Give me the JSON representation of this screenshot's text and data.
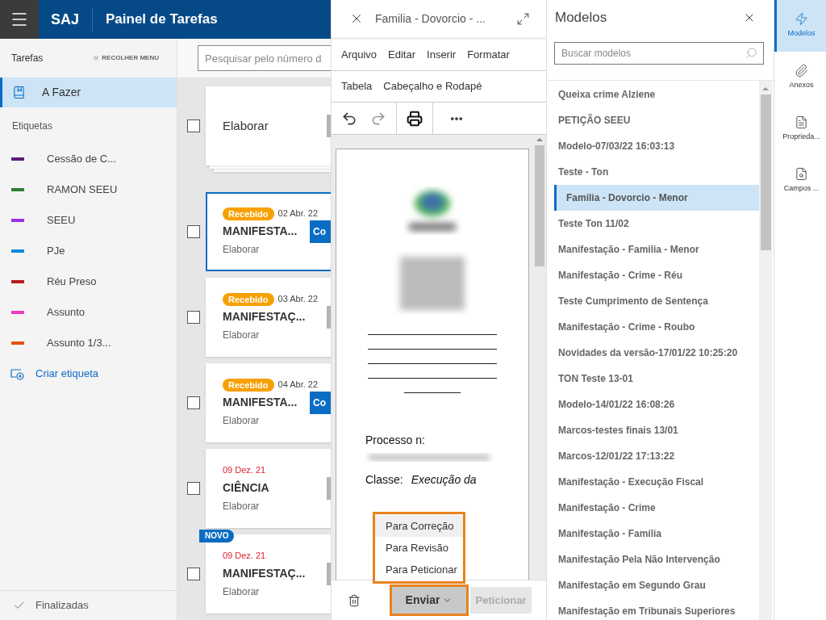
{
  "header": {
    "app_name": "SAJ",
    "title": "Painel de Tarefas"
  },
  "sidebar": {
    "section_title": "Tarefas",
    "collapse_label": "RECOLHER MENU",
    "items": [
      {
        "label": "A Fazer",
        "selected": true
      }
    ],
    "labels_title": "Etiquetas",
    "labels": [
      {
        "name": "Cessão de C...",
        "color": "#5c1a7a"
      },
      {
        "name": "RAMON SEEU",
        "color": "#2e7d32"
      },
      {
        "name": "SEEU",
        "color": "#9b30e6"
      },
      {
        "name": "PJe",
        "color": "#0a8ad6"
      },
      {
        "name": "Réu Preso",
        "color": "#b71c1c"
      },
      {
        "name": "Assunto",
        "color": "#f03cc0"
      },
      {
        "name": "Assunto 1/3...",
        "color": "#e65100"
      }
    ],
    "create_label": "Criar etiqueta",
    "footer": {
      "label": "Finalizadas"
    }
  },
  "task_list": {
    "search": {
      "placeholder": "Pesquisar pelo número d"
    },
    "tasks": [
      {
        "kind": "stack",
        "title": "Elaborar",
        "checked": false,
        "selected": false,
        "action": {
          "kind": "secondary"
        }
      },
      {
        "kind": "card",
        "status": "Recebido",
        "date": "02 Abr. 22",
        "overdue": false,
        "title": "MANIFESTA...",
        "subtitle": "Elaborar",
        "checked": false,
        "selected": true,
        "action": {
          "kind": "primary",
          "label": "Co"
        }
      },
      {
        "kind": "card",
        "status": "Recebido",
        "date": "03 Abr. 22",
        "overdue": false,
        "title": "MANIFESTAÇ...",
        "subtitle": "Elaborar",
        "checked": false,
        "selected": false,
        "action": {
          "kind": "secondary"
        }
      },
      {
        "kind": "card",
        "status": "Recebido",
        "date": "04 Abr. 22",
        "overdue": false,
        "title": "MANIFESTA...",
        "subtitle": "Elaborar",
        "checked": false,
        "selected": false,
        "action": {
          "kind": "primary",
          "label": "Co"
        }
      },
      {
        "kind": "card",
        "date": "09 Dez. 21",
        "overdue": true,
        "title": "CIÊNCIA",
        "subtitle": "Elaborar",
        "checked": false,
        "selected": false,
        "action": {
          "kind": "secondary"
        }
      },
      {
        "kind": "card",
        "badge": "NOVO",
        "date": "09 Dez. 21",
        "overdue": true,
        "title": "MANIFESTAÇ...",
        "subtitle": "Elaborar",
        "checked": false,
        "selected": false,
        "action": {
          "kind": "secondary"
        }
      }
    ]
  },
  "editor": {
    "title": "Familia - Dovorcio - ...",
    "menu_rows": [
      [
        "Arquivo",
        "Editar",
        "Inserir",
        "Formatar"
      ],
      [
        "Tabela",
        "Cabeçalho e Rodapé"
      ]
    ],
    "toolbar": {
      "redo_disabled": true
    },
    "document": {
      "process_label": "Processo n:",
      "class_label": "Classe:",
      "class_value": "Execução da"
    },
    "send_menu": {
      "annotated": true,
      "items": [
        {
          "label": "Para Correção",
          "selected": true
        },
        {
          "label": "Para Revisão",
          "selected": false
        },
        {
          "label": "Para Peticionar",
          "selected": false
        }
      ]
    },
    "send_button": {
      "label": "Enviar",
      "annotated": true
    },
    "petition_button": {
      "label": "Peticionar",
      "disabled": true
    }
  },
  "models": {
    "title": "Modelos",
    "search": {
      "placeholder": "Buscar modelos"
    },
    "items": [
      {
        "label": "Queixa crime Alziene",
        "selected": false
      },
      {
        "label": "PETIÇÃO SEEU",
        "selected": false
      },
      {
        "label": "Modelo-07/03/22 16:03:13",
        "selected": false
      },
      {
        "label": "Teste - Ton",
        "selected": false
      },
      {
        "label": "Familia - Dovorcio - Menor",
        "selected": true
      },
      {
        "label": "Teste Ton 11/02",
        "selected": false
      },
      {
        "label": "Manifestação - Familia - Menor",
        "selected": false
      },
      {
        "label": "Manifestação - Crime - Réu",
        "selected": false
      },
      {
        "label": "Teste Cumprimento de Sentença",
        "selected": false
      },
      {
        "label": "Manifestação - Crime - Roubo",
        "selected": false
      },
      {
        "label": "Novidades da versão-17/01/22 10:25:20",
        "selected": false
      },
      {
        "label": "TON Teste 13-01",
        "selected": false
      },
      {
        "label": "Modelo-14/01/22 16:08:26",
        "selected": false
      },
      {
        "label": "Marcos-testes finais 13/01",
        "selected": false
      },
      {
        "label": "Marcos-12/01/22 17:13:22",
        "selected": false
      },
      {
        "label": "Manifestação - Execução Fiscal",
        "selected": false
      },
      {
        "label": "Manifestação - Crime",
        "selected": false
      },
      {
        "label": "Manifestação - Família",
        "selected": false
      },
      {
        "label": "Manifestação Pela Não Intervenção",
        "selected": false
      },
      {
        "label": "Manifestação em Segundo Grau",
        "selected": false
      },
      {
        "label": "Manifestação em Tribunais Superiores",
        "selected": false
      }
    ]
  },
  "rail": {
    "items": [
      {
        "kind": "models",
        "label": "Modelos",
        "selected": true
      },
      {
        "kind": "attachments",
        "label": "Anexos",
        "selected": false
      },
      {
        "kind": "properties",
        "label": "Proprieda...",
        "selected": false
      },
      {
        "kind": "fields",
        "label": "Campos ...",
        "selected": false
      }
    ]
  }
}
